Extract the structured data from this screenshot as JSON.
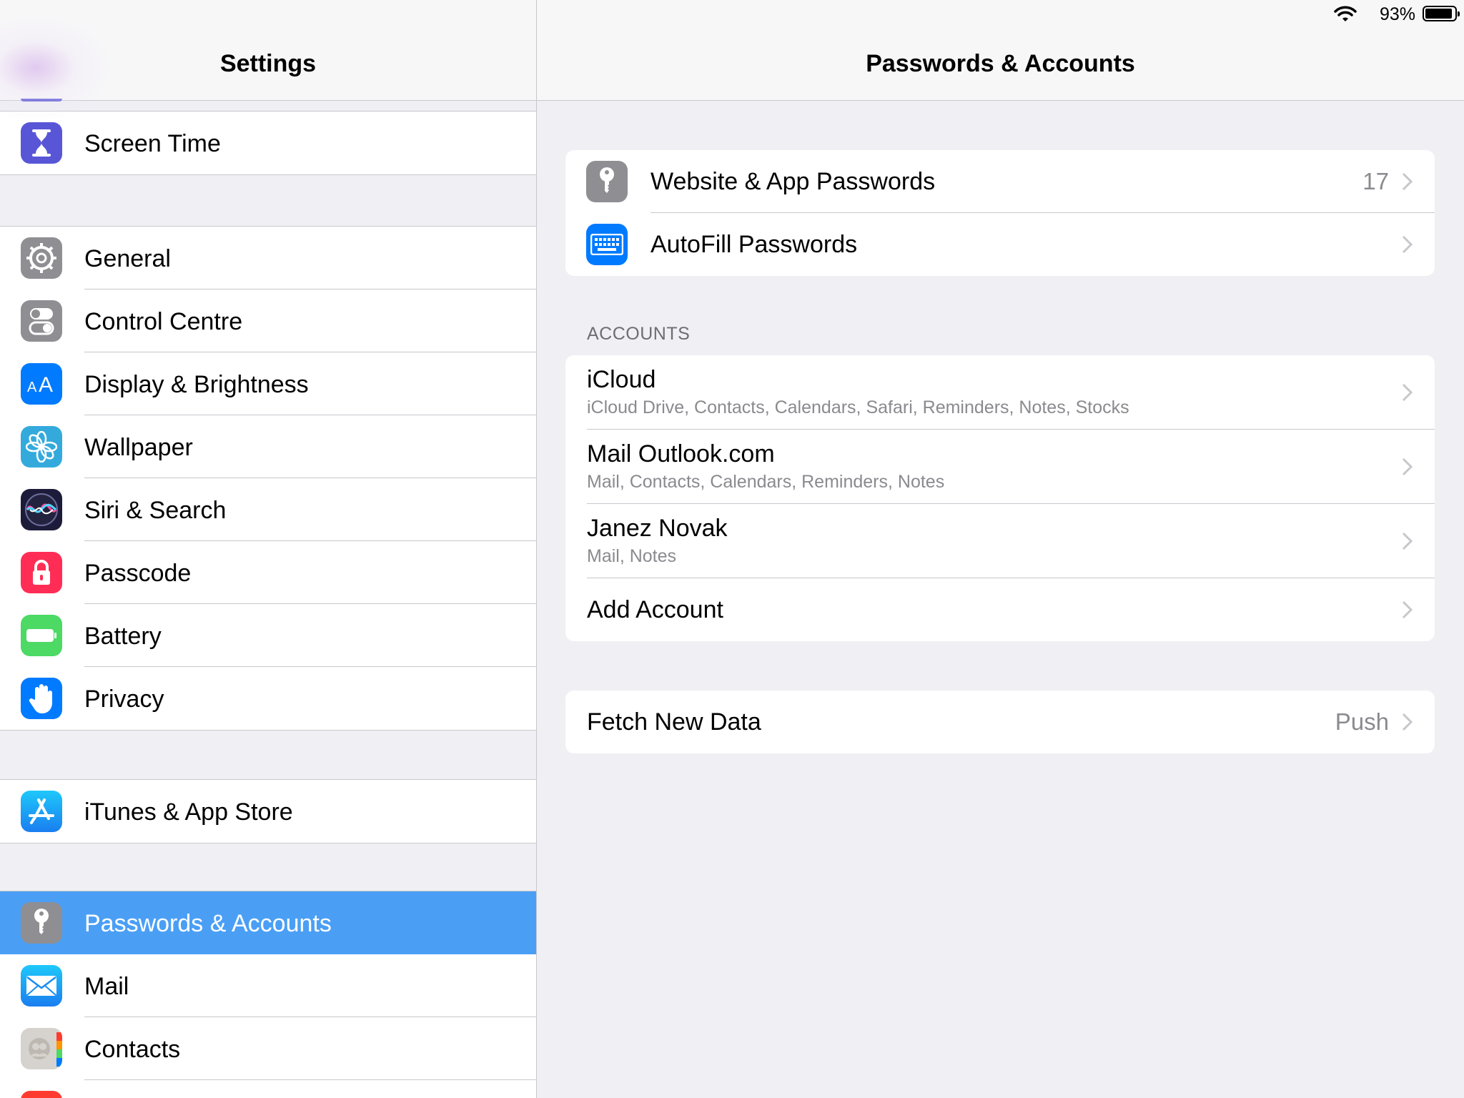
{
  "status_bar": {
    "battery_percent": "93%",
    "battery_level": 0.93
  },
  "left_pane": {
    "title": "Settings",
    "selected_item": "Passwords & Accounts",
    "groups": [
      {
        "items": [
          {
            "label": "Screen Time",
            "icon": "hourglass-icon",
            "color": "#5856d6"
          }
        ]
      },
      {
        "items": [
          {
            "label": "General",
            "icon": "gear-icon",
            "color": "#8e8e93"
          },
          {
            "label": "Control Centre",
            "icon": "toggles-icon",
            "color": "#8e8e93"
          },
          {
            "label": "Display & Brightness",
            "icon": "text-size-icon",
            "color": "#007aff"
          },
          {
            "label": "Wallpaper",
            "icon": "flower-icon",
            "color": "#34aadc"
          },
          {
            "label": "Siri & Search",
            "icon": "siri-icon",
            "color": "#1c1c3a"
          },
          {
            "label": "Passcode",
            "icon": "lock-icon",
            "color": "#ff2d55"
          },
          {
            "label": "Battery",
            "icon": "battery-icon",
            "color": "#4cd964"
          },
          {
            "label": "Privacy",
            "icon": "hand-icon",
            "color": "#007aff"
          }
        ]
      },
      {
        "items": [
          {
            "label": "iTunes & App Store",
            "icon": "app-store-icon",
            "color": "#1a8cf0"
          }
        ]
      },
      {
        "items": [
          {
            "label": "Passwords & Accounts",
            "icon": "key-icon",
            "color": "#8e8e93"
          },
          {
            "label": "Mail",
            "icon": "envelope-icon",
            "color": "#1a8cf0"
          },
          {
            "label": "Contacts",
            "icon": "contacts-icon",
            "color": "#d6d3ce"
          }
        ]
      }
    ]
  },
  "right_pane": {
    "title": "Passwords & Accounts",
    "passwords": [
      {
        "label": "Website & App Passwords",
        "value": "17",
        "icon": "key-icon",
        "color": "#8e8e93"
      },
      {
        "label": "AutoFill Passwords",
        "icon": "keyboard-icon",
        "color": "#007aff"
      }
    ],
    "accounts_header": "ACCOUNTS",
    "accounts": [
      {
        "title": "iCloud",
        "subtitle": "iCloud Drive, Contacts, Calendars, Safari, Reminders, Notes, Stocks"
      },
      {
        "title": "Mail Outlook.com",
        "subtitle": "Mail, Contacts, Calendars, Reminders, Notes"
      },
      {
        "title": "Janez Novak",
        "subtitle": "Mail, Notes"
      }
    ],
    "add_account": "Add Account",
    "fetch": {
      "label": "Fetch New Data",
      "value": "Push"
    }
  }
}
